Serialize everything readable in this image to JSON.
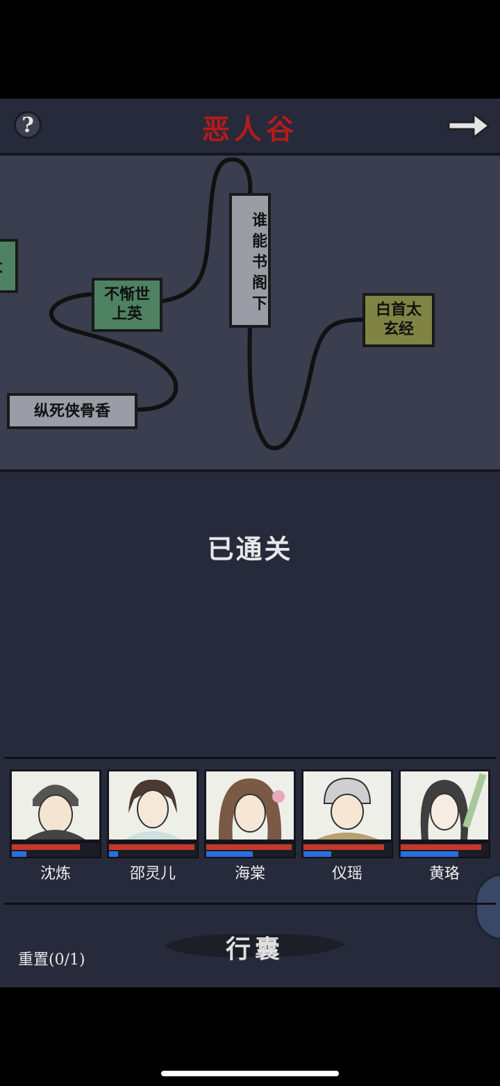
{
  "header": {
    "help_icon": "?",
    "title": "恶人谷"
  },
  "map": {
    "nodes": [
      {
        "label": "不惭世上英",
        "line1": "不惭世",
        "line2": "上英",
        "color": "#4e8262"
      },
      {
        "label": "谁能书阁下",
        "color": "#9a9ca6"
      },
      {
        "label": "白首太玄经",
        "line1": "白首太",
        "line2": "玄经",
        "color": "#7f8445"
      },
      {
        "label": "纵死侠骨香",
        "color": "#9a9ca6"
      },
      {
        "label": "大",
        "color": "#4e8262"
      }
    ]
  },
  "status_text": "已通关",
  "party": [
    {
      "name": "沈炼",
      "hp": 0.78,
      "mp": 0.17
    },
    {
      "name": "邵灵儿",
      "hp": 0.98,
      "mp": 0.1
    },
    {
      "name": "海棠",
      "hp": 0.98,
      "mp": 0.53
    },
    {
      "name": "仪瑶",
      "hp": 0.92,
      "mp": 0.32
    },
    {
      "name": "黄珞",
      "hp": 0.92,
      "mp": 0.66
    }
  ],
  "bag_label": "行囊",
  "reset_label": "重置(0/1)",
  "colors": {
    "title": "#b31b1b",
    "hp": "#c33a2c",
    "mp": "#2a6ee0",
    "background": "#262a3a"
  }
}
